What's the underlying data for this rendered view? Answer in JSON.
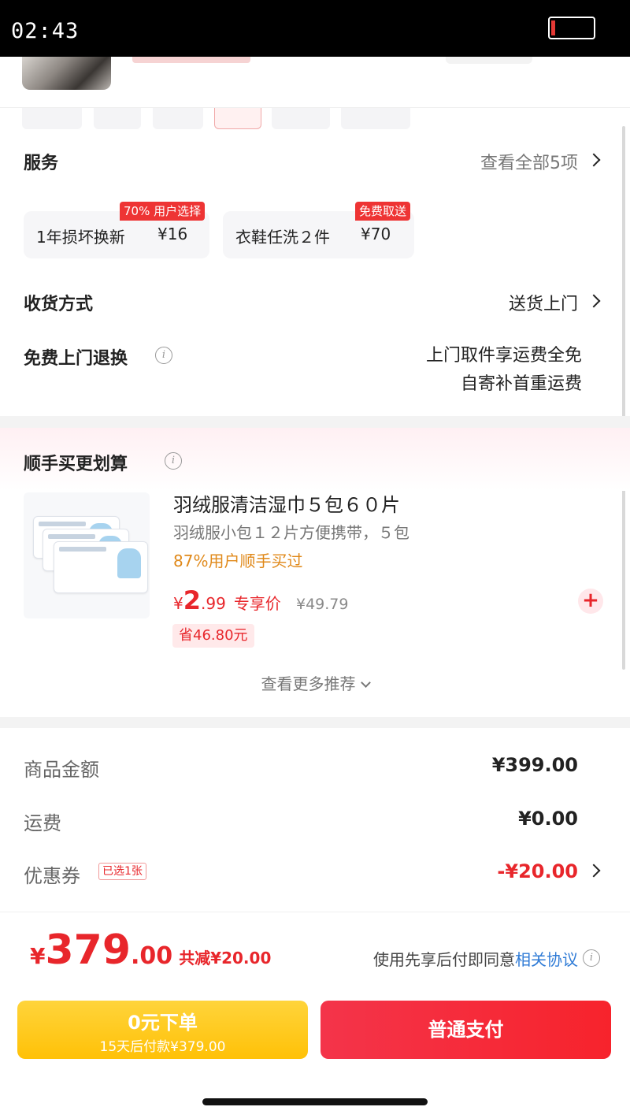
{
  "status_bar": {
    "time": "02:43"
  },
  "services": {
    "title": "服务",
    "view_all": "查看全部5项",
    "options": [
      {
        "badge": "70% 用户选择",
        "name": "1年损坏换新",
        "price": "¥16"
      },
      {
        "badge": "免费取送",
        "name": "衣鞋任洗２件",
        "price": "¥70"
      }
    ]
  },
  "delivery": {
    "title": "收货方式",
    "value": "送货上门"
  },
  "free_return": {
    "title": "免费上门退换",
    "line1": "上门取件享运费全免",
    "line2": "自寄补首重运费"
  },
  "upsell": {
    "title": "顺手买更划算",
    "item": {
      "title": "羽绒服清洁湿巾５包６０片",
      "subtitle": "羽绒服小包１２片方便携带，５包",
      "popularity": "87%用户顺手买过",
      "price_currency": "¥",
      "price_int": "2",
      "price_dec": ".99",
      "price_tag": "专享价",
      "original_price": "¥49.79",
      "savings": "省46.80元",
      "add_symbol": "+"
    },
    "more": "查看更多推荐"
  },
  "summary": {
    "goods_label": "商品金额",
    "goods_value": "¥399.00",
    "shipping_label": "运费",
    "shipping_value": "¥0.00",
    "coupon_label": "优惠券",
    "coupon_tag": "已选1张",
    "coupon_value": "-¥20.00"
  },
  "footer": {
    "total_currency": "¥",
    "total_int": "379",
    "total_dec": ".00",
    "total_discount": "共减¥20.00",
    "agreement_prefix": "使用先享后付即同意",
    "agreement_link": "相关协议",
    "btn_zero_main": "0元下单",
    "btn_zero_sub": "15天后付款¥379.00",
    "btn_pay": "普通支付"
  },
  "colors": {
    "accent_red": "#e8262b",
    "badge_red": "#ee3434",
    "pay_yellow": "#ffc107",
    "link_blue": "#2f7bd6",
    "popularity_orange": "#e0891a"
  },
  "icons": [
    "battery-icon",
    "chevron-right-icon",
    "info-icon",
    "plus-icon",
    "chevron-down-icon"
  ]
}
